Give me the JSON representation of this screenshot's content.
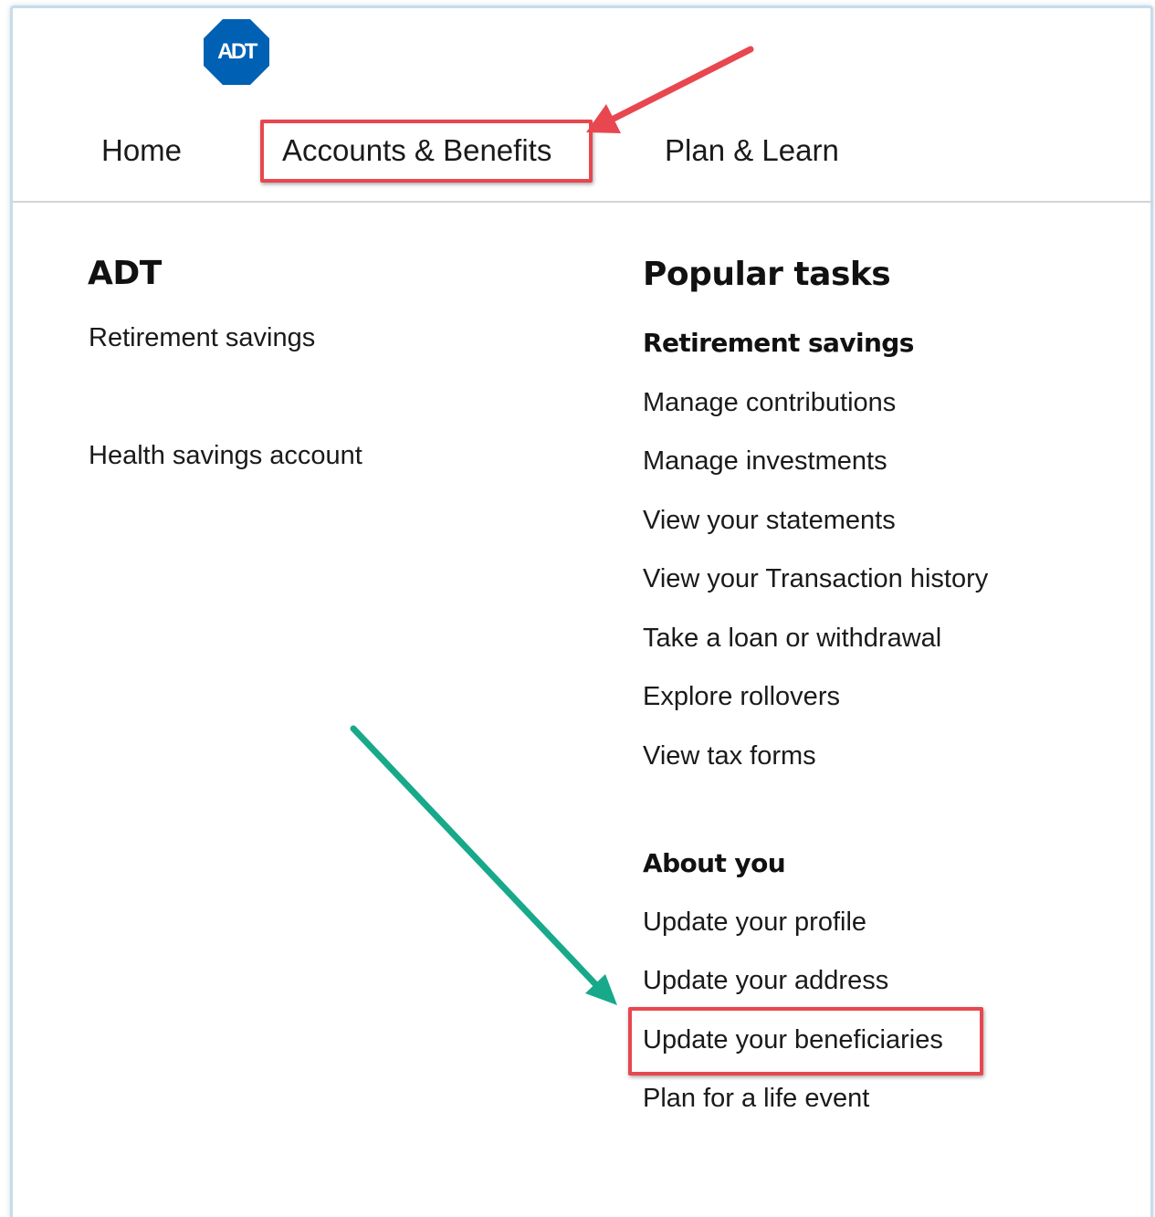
{
  "logo": {
    "text": "ADT",
    "color": "#0061b4"
  },
  "nav": {
    "items": [
      {
        "label": "Home"
      },
      {
        "label": "Accounts & Benefits",
        "highlighted": true
      },
      {
        "label": "Plan & Learn"
      }
    ]
  },
  "left_column": {
    "heading": "ADT",
    "links": [
      {
        "label": "Retirement savings"
      },
      {
        "label": "Health savings account"
      }
    ]
  },
  "popular_tasks": {
    "heading": "Popular tasks",
    "sections": [
      {
        "title": "Retirement savings",
        "links": [
          {
            "label": "Manage contributions"
          },
          {
            "label": "Manage investments"
          },
          {
            "label": "View your statements"
          },
          {
            "label": "View your Transaction history"
          },
          {
            "label": "Take a loan or withdrawal"
          },
          {
            "label": "Explore rollovers"
          },
          {
            "label": "View tax forms"
          }
        ]
      },
      {
        "title": "About you",
        "links": [
          {
            "label": "Update your profile"
          },
          {
            "label": "Update your address"
          },
          {
            "label": "Update your beneficiaries",
            "highlighted": true
          },
          {
            "label": "Plan for a life event"
          }
        ]
      }
    ]
  },
  "annotations": {
    "highlight_color": "#e8474f",
    "red_arrow_color": "#e8474f",
    "green_arrow_color": "#17a98a"
  }
}
